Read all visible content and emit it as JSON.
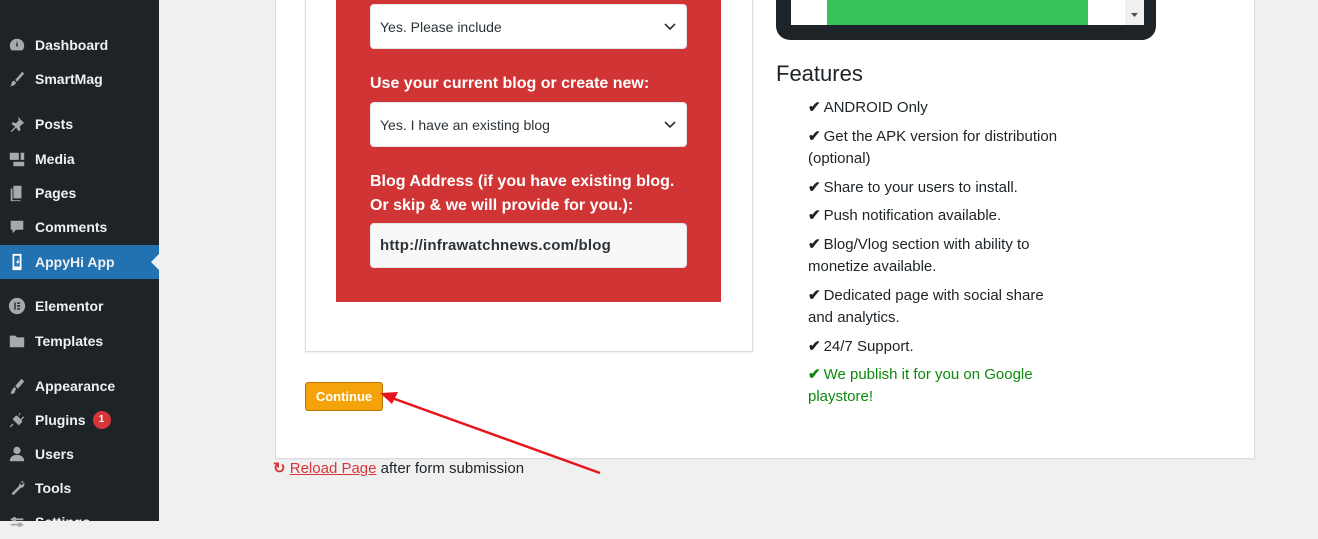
{
  "sidebar": {
    "items": [
      {
        "label": "Dashboard",
        "icon": "dashboard-icon"
      },
      {
        "label": "SmartMag",
        "icon": "brush-icon"
      },
      {
        "label": "Posts",
        "icon": "pin-icon"
      },
      {
        "label": "Media",
        "icon": "media-icon"
      },
      {
        "label": "Pages",
        "icon": "pages-icon"
      },
      {
        "label": "Comments",
        "icon": "comments-icon"
      },
      {
        "label": "AppyHi App",
        "icon": "phone-icon"
      },
      {
        "label": "Elementor",
        "icon": "elementor-icon"
      },
      {
        "label": "Templates",
        "icon": "folder-icon"
      },
      {
        "label": "Appearance",
        "icon": "appearance-icon"
      },
      {
        "label": "Plugins",
        "icon": "plugin-icon",
        "badge": "1"
      },
      {
        "label": "Users",
        "icon": "users-icon"
      },
      {
        "label": "Tools",
        "icon": "tools-icon"
      },
      {
        "label": "Settings",
        "icon": "settings-icon"
      }
    ],
    "active": "AppyHi App"
  },
  "form": {
    "include_select_value": "Yes. Please include",
    "blog_label": "Use your current blog or create new:",
    "blog_select_value": "Yes. I have an existing blog",
    "address_label": "Blog Address (if you have existing blog. Or skip & we will provide for you.):",
    "address_value": "http://infrawatchnews.com/blog"
  },
  "continue_label": "Continue",
  "reload": {
    "link": "Reload Page",
    "suffix": "after form submission"
  },
  "features": {
    "title": "Features",
    "items": [
      "ANDROID Only",
      "Get the APK version for distribution (optional)",
      "Share to your users to install.",
      "Push notification available.",
      "Blog/Vlog section with ability to monetize available.",
      "Dedicated page with social share and analytics.",
      "24/7 Support.",
      "We publish it for you on Google playstore!"
    ]
  },
  "colors": {
    "sidebar_bg": "#1d2327",
    "active": "#2271b1",
    "red_panel": "#d03434",
    "continue": "#f5a30a",
    "green_text": "#0d8a0d",
    "arrow": "#e8141b"
  }
}
